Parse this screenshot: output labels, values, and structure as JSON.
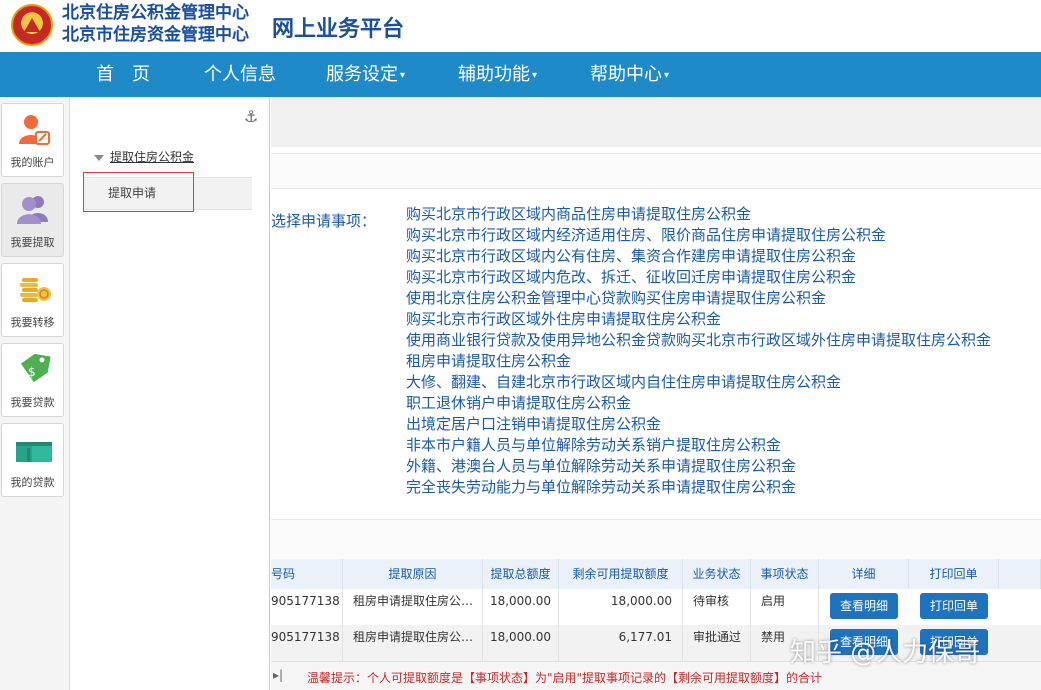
{
  "header": {
    "org_line1": "北京住房公积金管理中心",
    "org_line2": "北京市住房资金管理中心",
    "platform_title": "网上业务平台"
  },
  "nav": {
    "items": [
      {
        "label": "首　页"
      },
      {
        "label": "个人信息"
      },
      {
        "label": "服务设定"
      },
      {
        "label": "辅助功能"
      },
      {
        "label": "帮助中心"
      }
    ]
  },
  "iconbar": {
    "items": [
      {
        "label": "我的账户",
        "icon": "account-icon"
      },
      {
        "label": "我要提取",
        "icon": "users-icon"
      },
      {
        "label": "我要转移",
        "icon": "coins-icon"
      },
      {
        "label": "我要贷款",
        "icon": "price-tag-icon"
      },
      {
        "label": "我的贷款",
        "icon": "money-stack-icon"
      }
    ]
  },
  "submenu": {
    "group_label": "提取住房公积金",
    "item_label": "提取申请"
  },
  "main": {
    "select_label": "选择申请事项：",
    "reasons": [
      "购买北京市行政区域内商品住房申请提取住房公积金",
      "购买北京市行政区域内经济适用住房、限价商品住房申请提取住房公积金",
      "购买北京市行政区域内公有住房、集资合作建房申请提取住房公积金",
      "购买北京市行政区域内危改、拆迁、征收回迁房申请提取住房公积金",
      "使用北京住房公积金管理中心贷款购买住房申请提取住房公积金",
      "购买北京市行政区域外住房申请提取住房公积金",
      "使用商业银行贷款及使用异地公积金贷款购买北京市行政区域外住房申请提取住房公积金",
      "租房申请提取住房公积金",
      "大修、翻建、自建北京市行政区域内自住住房申请提取住房公积金",
      "职工退休销户申请提取住房公积金",
      "出境定居户口注销申请提取住房公积金",
      "非本市户籍人员与单位解除劳动关系销户提取住房公积金",
      "外籍、港澳台人员与单位解除劳动关系申请提取住房公积金",
      "完全丧失劳动能力与单位解除劳动关系申请提取住房公积金"
    ]
  },
  "table": {
    "headers": [
      "号码",
      "提取原因",
      "提取总额度",
      "剩余可用提取额度",
      "业务状态",
      "事项状态",
      "详细",
      "打印回单"
    ],
    "rows": [
      {
        "no": "905177138",
        "reason": "租房申请提取住房公…",
        "total": "18,000.00",
        "remaining": "18,000.00",
        "biz_status": "待审核",
        "item_status": "启用",
        "detail_btn": "查看明细",
        "print_btn": "打印回单"
      },
      {
        "no": "905177138",
        "reason": "租房申请提取住房公…",
        "total": "18,000.00",
        "remaining": "6,177.01",
        "biz_status": "审批通过",
        "item_status": "禁用",
        "detail_btn": "查看明细",
        "print_btn": "打印回单"
      }
    ]
  },
  "footer": {
    "pager_symbol": "▸|",
    "tip": "温馨提示：个人可提取额度是【事项状态】为\"启用\"提取事项记录的【剩余可用提取额度】的合计"
  },
  "watermark": "知乎 @人力保哥",
  "colors": {
    "nav_bg": "#1e8ac8",
    "link": "#1a5aa8",
    "button": "#1e73be",
    "tip": "#c62828"
  }
}
